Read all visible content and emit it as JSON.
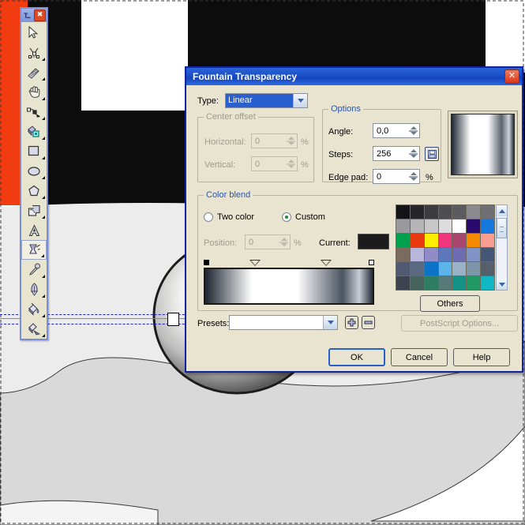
{
  "toolbox": {
    "title": "T...",
    "close_label": "✖",
    "tools": [
      {
        "name": "pick-tool",
        "icon": "arrow-cursor-icon",
        "selected": false,
        "flyout": false
      },
      {
        "name": "shape-edit-tool",
        "icon": "node-edit-icon",
        "selected": false,
        "flyout": true
      },
      {
        "name": "crop-tool",
        "icon": "knife-crop-icon",
        "selected": false,
        "flyout": true
      },
      {
        "name": "zoom-pan-tool",
        "icon": "hand-pan-icon",
        "selected": false,
        "flyout": true
      },
      {
        "name": "freehand-tool",
        "icon": "bezier-curve-icon",
        "selected": false,
        "flyout": true
      },
      {
        "name": "smart-fill-tool",
        "icon": "smart-fill-icon",
        "selected": false,
        "flyout": true
      },
      {
        "name": "rectangle-tool",
        "icon": "rectangle-icon",
        "selected": false,
        "flyout": true
      },
      {
        "name": "ellipse-tool",
        "icon": "ellipse-icon",
        "selected": false,
        "flyout": true
      },
      {
        "name": "polygon-tool",
        "icon": "polygon-icon",
        "selected": false,
        "flyout": true
      },
      {
        "name": "perfect-shapes-tool",
        "icon": "shapes-stack-icon",
        "selected": false,
        "flyout": true
      },
      {
        "name": "text-tool",
        "icon": "letter-a-icon",
        "selected": false,
        "flyout": false
      },
      {
        "name": "interactive-transparency-tool",
        "icon": "transparency-glass-icon",
        "selected": true,
        "flyout": true
      },
      {
        "name": "eyedropper-tool",
        "icon": "eyedropper-icon",
        "selected": false,
        "flyout": true
      },
      {
        "name": "outline-pen-tool",
        "icon": "pen-nib-icon",
        "selected": false,
        "flyout": true
      },
      {
        "name": "fill-tool",
        "icon": "paint-bucket-icon",
        "selected": false,
        "flyout": true
      },
      {
        "name": "interactive-fill-tool",
        "icon": "interactive-fill-icon",
        "selected": false,
        "flyout": true
      }
    ]
  },
  "dialog": {
    "title": "Fountain Transparency",
    "close_label": "✕",
    "type_label": "Type:",
    "type_value": "Linear",
    "center_offset": {
      "legend": "Center offset",
      "horizontal_label": "Horizontal:",
      "horizontal_value": "0",
      "vertical_label": "Vertical:",
      "vertical_value": "0",
      "percent": "%"
    },
    "options": {
      "legend": "Options",
      "angle_label": "Angle:",
      "angle_value": "0,0",
      "steps_label": "Steps:",
      "steps_value": "256",
      "edge_pad_label": "Edge pad:",
      "edge_pad_value": "0",
      "percent": "%",
      "lock_icon": "lock-steps-icon"
    },
    "color_blend": {
      "legend": "Color blend",
      "two_color_label": "Two color",
      "custom_label": "Custom",
      "two_color_selected": false,
      "custom_selected": true,
      "position_label": "Position:",
      "position_value": "0",
      "percent": "%",
      "current_label": "Current:",
      "current_color": "#1b1b1b",
      "others_label": "Others"
    },
    "presets_label": "Presets:",
    "presets_value": "",
    "add_preset_icon": "plus-icon",
    "remove_preset_icon": "minus-icon",
    "postscript_label": "PostScript Options...",
    "ok_label": "OK",
    "cancel_label": "Cancel",
    "help_label": "Help"
  },
  "palette": {
    "rows": [
      [
        "#141416",
        "#25252a",
        "#3b3b40",
        "#4d4d52",
        "#5c5c60",
        "#8b8b8f",
        "#6e6e73"
      ],
      [
        "#9a9a9e",
        "#b5b5b8",
        "#c8c8cb",
        "#dcdcdf",
        "#ffffff",
        "#2a0a6e",
        "#1478dc"
      ],
      [
        "#00a04e",
        "#ea3a10",
        "#ffec00",
        "#f0357d",
        "#a8466e",
        "#f58a00",
        "#fb9e92"
      ],
      [
        "#7b6a5e",
        "#b9b6dc",
        "#8f8cc8",
        "#5b78bc",
        "#6f6bb0",
        "#7f93c6",
        "#455777"
      ],
      [
        "#505a70",
        "#5b6a80",
        "#0a73c8",
        "#5cb4ea",
        "#9ab2c8",
        "#7e94a8",
        "#55606a"
      ],
      [
        "#3d4450",
        "#46625c",
        "#2e7d63",
        "#567a78",
        "#149286",
        "#1f9a64",
        "#10b8c4"
      ]
    ],
    "scroll_up_icon": "chevron-up-icon",
    "scroll_down_icon": "chevron-down-icon"
  },
  "gradient": {
    "stops": [
      {
        "pos": 0,
        "color": "#1c2430"
      },
      {
        "pos": 28,
        "color": "#ffffff"
      },
      {
        "pos": 55,
        "color": "#ffffff"
      },
      {
        "pos": 82,
        "color": "#4a5360"
      },
      {
        "pos": 92,
        "color": "#c8cdd4"
      },
      {
        "pos": 100,
        "color": "#242c38"
      }
    ],
    "markers": [
      {
        "type": "square-filled",
        "pos": 0
      },
      {
        "type": "triangle",
        "pos": 28
      },
      {
        "type": "triangle",
        "pos": 69
      },
      {
        "type": "square-hollow",
        "pos": 100
      }
    ]
  },
  "preview": {
    "stops": [
      {
        "pos": 0,
        "color": "#1e2734"
      },
      {
        "pos": 30,
        "color": "#ffffff"
      },
      {
        "pos": 58,
        "color": "#ffffff"
      },
      {
        "pos": 80,
        "color": "#5a636e"
      },
      {
        "pos": 92,
        "color": "#cfd3d9"
      },
      {
        "pos": 100,
        "color": "#222a36"
      }
    ]
  },
  "canvas": {
    "orange": "#f03c10",
    "black": "#0c0c0c",
    "white": "#ffffff",
    "light_gray": "#ececec",
    "mid_gray": "#d9d9d9",
    "outline": "#3a3a3a",
    "blue_stroke": "#1040e8"
  }
}
